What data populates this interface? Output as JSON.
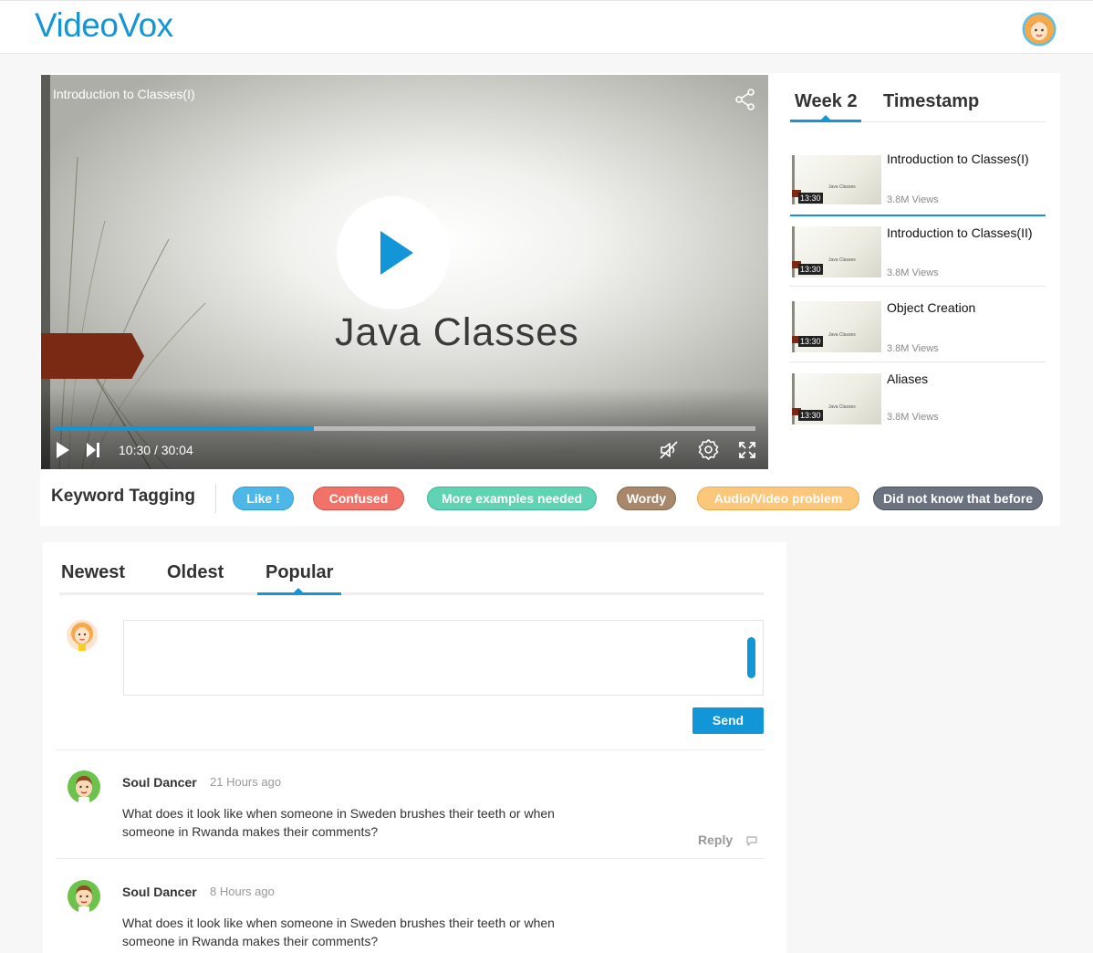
{
  "app": {
    "logo": "VideoVox"
  },
  "header": {
    "avatar_icon": "user-avatar-icon"
  },
  "player": {
    "title": "Introduction to Classes(I)",
    "slide_text": "Java Classes",
    "current_time": "10:30",
    "time_separator": "/",
    "duration": "30:04",
    "progress": 0.37,
    "icons": [
      "share-icon",
      "play-icon",
      "skip-next-icon",
      "mute-icon",
      "settings-icon",
      "fullscreen-icon"
    ]
  },
  "playlist": {
    "tabs": [
      "Week 2",
      "Timestamp"
    ],
    "active_tab": "Week 2",
    "items": [
      {
        "title": "Introduction to Classes(I)",
        "views": "3.8M  Views",
        "duration": "13:30",
        "thumb_text": "Java Classes"
      },
      {
        "title": "Introduction to Classes(II)",
        "views": "3.8M  Views",
        "duration": "13:30",
        "thumb_text": "Java Classes"
      },
      {
        "title": "Object Creation",
        "views": "3.8M  Views",
        "duration": "13:30",
        "thumb_text": "Java Classes"
      },
      {
        "title": "Aliases",
        "views": "3.8M  Views",
        "duration": "13:30",
        "thumb_text": "Java Classes"
      }
    ]
  },
  "keywords": {
    "label": "Keyword Tagging",
    "tags": [
      {
        "label": "Like !",
        "color": "#4db8e8",
        "border": "#2a9fd6"
      },
      {
        "label": "Confused",
        "color": "#f07268",
        "border": "#d94f45"
      },
      {
        "label": "More examples  needed",
        "color": "#5fd3b3",
        "border": "#3cb896"
      },
      {
        "label": "Wordy",
        "color": "#a8876a",
        "border": "#8a6a4e"
      },
      {
        "label": "Audio/Video problem",
        "color": "#fbc77a",
        "border": "#eeaa48"
      },
      {
        "label": "Did not know that before",
        "color": "#6b7280",
        "border": "#4b5260"
      }
    ]
  },
  "comments": {
    "tabs": [
      "Newest",
      "Oldest",
      "Popular"
    ],
    "active_tab": "Popular",
    "send_label": "Send",
    "list": [
      {
        "author": "Soul Dancer",
        "time": "21 Hours ago",
        "text": "What does it look like when someone in Sweden brushes their teeth or when someone in Rwanda makes their comments?",
        "reply_label": "Reply"
      },
      {
        "author": "Soul Dancer",
        "time": "8 Hours ago",
        "text": "What does it look like when someone in Sweden brushes their teeth or when someone in Rwanda makes their comments?"
      }
    ]
  }
}
